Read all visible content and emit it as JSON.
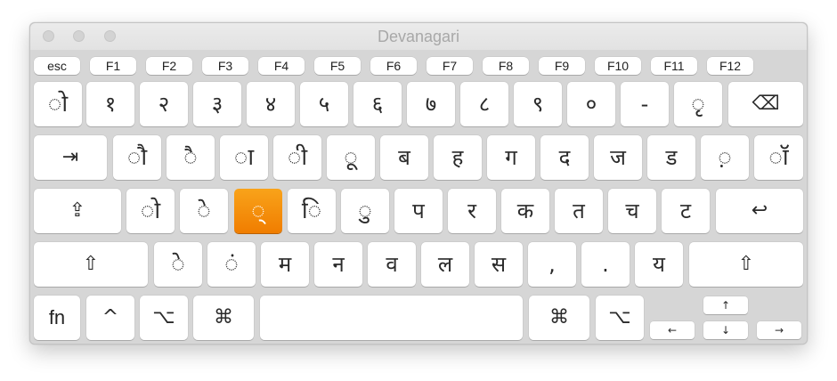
{
  "window": {
    "title": "Devanagari"
  },
  "colors": {
    "highlight": "#f5921e",
    "key_bg": "#ffffff",
    "board_bg": "#d6d6d6"
  },
  "function_row": [
    "esc",
    "F1",
    "F2",
    "F3",
    "F4",
    "F5",
    "F6",
    "F7",
    "F8",
    "F9",
    "F10",
    "F11",
    "F12"
  ],
  "number_row": {
    "keys": [
      "◌ो",
      "१",
      "२",
      "३",
      "४",
      "५",
      "६",
      "७",
      "८",
      "९",
      "०",
      "-",
      "◌ृ"
    ],
    "delete_icon": "⌫"
  },
  "top_row": {
    "tab_icon": "⇥",
    "keys": [
      "◌ौ",
      "◌ै",
      "◌ा",
      "◌ी",
      "◌ू",
      "ब",
      "ह",
      "ग",
      "द",
      "ज",
      "ड",
      "◌़",
      "◌ॉ"
    ]
  },
  "home_row": {
    "caps_icon": "⇪",
    "keys": [
      "◌ो",
      "◌े",
      "◌्",
      "◌ि",
      "◌ु",
      "प",
      "र",
      "क",
      "त",
      "च",
      "ट"
    ],
    "return_icon": "↩"
  },
  "bottom_row": {
    "shift_icon": "⇧",
    "keys": [
      "◌े",
      "◌ं",
      "म",
      "न",
      "व",
      "ल",
      "स",
      ",",
      ".",
      "य"
    ],
    "right_shift_icon": "⇧"
  },
  "space_row": {
    "fn": "fn",
    "control": "^",
    "option": "⌥",
    "command": "⌘",
    "right_command": "⌘",
    "right_option": "⌥",
    "arrow_up": "↑",
    "arrow_down": "↓",
    "arrow_left": "←",
    "arrow_right": "→"
  },
  "highlighted_key": "◌्"
}
